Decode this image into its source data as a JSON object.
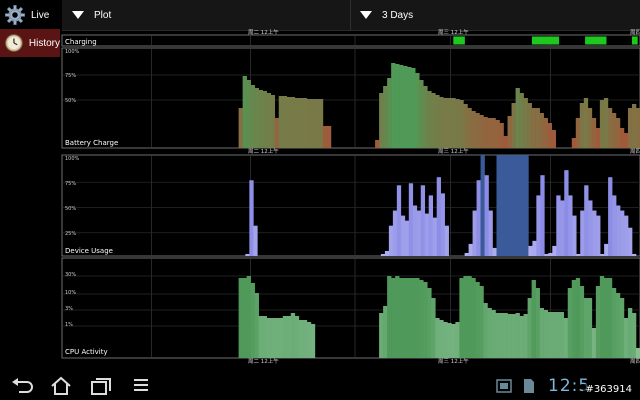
{
  "sidebar": {
    "items": [
      {
        "label": "Live",
        "icon": "gear-icon"
      },
      {
        "label": "History",
        "icon": "clock-icon",
        "selected": true
      }
    ]
  },
  "toolbar": {
    "plot_label": "Plot",
    "range_label": "3 Days"
  },
  "colors": {
    "selected_bg": "#5a1414",
    "charging": "#1ec81e",
    "battery_high": "#4f9a56",
    "battery_low": "#a05a3a",
    "device_usage": "#8c8ce6",
    "device_usage_dark": "#3a5a9a",
    "cpu": "#4f9a5a"
  },
  "time_labels": [
    "周二 12上午",
    "周三 12上午",
    "周四 12上午"
  ],
  "chart_data": [
    {
      "type": "bar",
      "title": "Charging",
      "intervals": [
        [
          0.677,
          0.697
        ],
        [
          0.813,
          0.86
        ],
        [
          0.905,
          0.942
        ],
        [
          0.986,
          0.996
        ]
      ]
    },
    {
      "type": "bar",
      "title": "Battery Charge",
      "ylabel_ticks": [
        "100%",
        "75%",
        "50%"
      ],
      "ylim": [
        0,
        100
      ],
      "values": [
        0,
        0,
        0,
        0,
        0,
        0,
        0,
        0,
        0,
        0,
        0,
        0,
        0,
        0,
        0,
        0,
        0,
        0,
        0,
        0,
        0,
        0,
        0,
        0,
        0,
        0,
        0,
        0,
        0,
        0,
        0,
        0,
        0,
        0,
        0,
        0,
        0,
        0,
        0,
        0,
        0,
        0,
        0,
        0,
        40,
        72,
        68,
        63,
        60,
        58,
        57,
        55,
        53,
        30,
        52,
        52,
        51,
        51,
        50,
        50,
        50,
        49,
        49,
        49,
        49,
        22,
        22,
        0,
        0,
        0,
        0,
        0,
        0,
        0,
        0,
        0,
        0,
        0,
        8,
        55,
        62,
        70,
        85,
        84,
        83,
        82,
        81,
        80,
        75,
        68,
        62,
        57,
        55,
        53,
        51,
        50,
        50,
        50,
        49,
        48,
        44,
        40,
        37,
        35,
        33,
        31,
        30,
        30,
        28,
        25,
        12,
        32,
        45,
        60,
        55,
        50,
        45,
        40,
        40,
        35,
        30,
        25,
        18,
        0,
        0,
        0,
        0,
        10,
        30,
        45,
        50,
        40,
        30,
        20,
        48,
        50,
        40,
        35,
        30,
        20,
        15,
        40,
        44,
        40
      ],
      "x_range": [
        0,
        144
      ]
    },
    {
      "type": "bar",
      "title": "Device Usage",
      "ylabel_ticks": [
        "100%",
        "75%",
        "50%",
        "25%"
      ],
      "ylim": [
        0,
        100
      ],
      "values": [
        0,
        0,
        0,
        0,
        0,
        0,
        0,
        0,
        0,
        0,
        0,
        0,
        0,
        0,
        0,
        0,
        0,
        0,
        0,
        0,
        0,
        0,
        0,
        0,
        0,
        0,
        0,
        0,
        0,
        0,
        0,
        0,
        0,
        0,
        0,
        0,
        0,
        0,
        0,
        0,
        0,
        0,
        0,
        0,
        0,
        0,
        2,
        75,
        30,
        0,
        0,
        0,
        0,
        0,
        0,
        0,
        0,
        0,
        0,
        0,
        0,
        0,
        0,
        0,
        0,
        0,
        0,
        0,
        0,
        0,
        0,
        0,
        0,
        0,
        0,
        0,
        0,
        0,
        0,
        0,
        2,
        5,
        30,
        45,
        70,
        40,
        35,
        72,
        50,
        45,
        70,
        42,
        60,
        38,
        78,
        62,
        30,
        0,
        0,
        0,
        0,
        3,
        12,
        45,
        75,
        100,
        80,
        45,
        8,
        100,
        100,
        100,
        100,
        100,
        100,
        100,
        100,
        10,
        15,
        60,
        80,
        2,
        3,
        10,
        60,
        55,
        85,
        60,
        40,
        2,
        45,
        70,
        55,
        45,
        40,
        2,
        12,
        78,
        60,
        50,
        45,
        40,
        28,
        2,
        0
      ],
      "x_range": [
        0,
        144
      ]
    },
    {
      "type": "bar",
      "title": "CPU Activity",
      "ylabel_ticks": [
        "30%",
        "10%",
        "3%",
        "1%"
      ],
      "ylim": [
        0,
        100
      ],
      "values": [
        0,
        0,
        0,
        0,
        0,
        0,
        0,
        0,
        0,
        0,
        0,
        0,
        0,
        0,
        0,
        0,
        0,
        0,
        0,
        0,
        0,
        0,
        0,
        0,
        0,
        0,
        0,
        0,
        0,
        0,
        0,
        0,
        0,
        0,
        0,
        0,
        0,
        0,
        0,
        0,
        0,
        0,
        0,
        0,
        80,
        80,
        82,
        75,
        65,
        42,
        42,
        40,
        40,
        40,
        40,
        42,
        42,
        45,
        42,
        38,
        38,
        36,
        34,
        0,
        0,
        0,
        0,
        0,
        0,
        0,
        0,
        0,
        0,
        0,
        0,
        0,
        0,
        0,
        0,
        45,
        52,
        82,
        80,
        82,
        80,
        80,
        80,
        80,
        80,
        78,
        76,
        70,
        60,
        40,
        38,
        36,
        35,
        34,
        36,
        80,
        82,
        82,
        80,
        76,
        72,
        55,
        50,
        48,
        45,
        45,
        45,
        44,
        44,
        45,
        42,
        44,
        60,
        78,
        70,
        50,
        48,
        46,
        46,
        46,
        46,
        40,
        70,
        78,
        80,
        72,
        60,
        60,
        30,
        72,
        82,
        80,
        80,
        70,
        65,
        60,
        40,
        50,
        45,
        10
      ],
      "x_range": [
        0,
        144
      ]
    }
  ]
}
